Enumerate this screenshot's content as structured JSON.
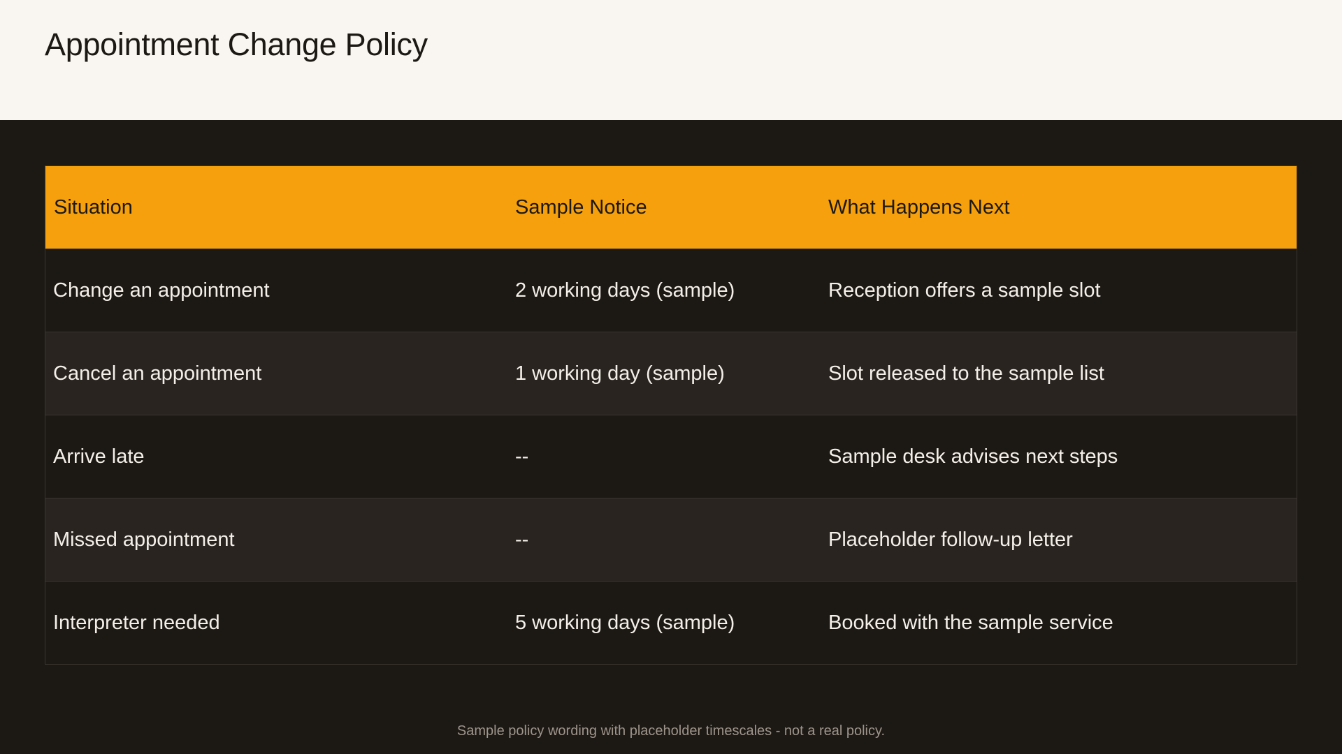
{
  "page": {
    "title": "Appointment Change Policy",
    "footnote": "Sample policy wording with placeholder timescales - not a real policy."
  },
  "table": {
    "headers": [
      "Situation",
      "Sample Notice",
      "What Happens Next"
    ],
    "rows": [
      [
        "Change an appointment",
        "2 working days (sample)",
        "Reception offers a sample slot"
      ],
      [
        "Cancel an appointment",
        "1 working day (sample)",
        "Slot released to the sample list"
      ],
      [
        "Arrive late",
        "--",
        "Sample desk advises next steps"
      ],
      [
        "Missed appointment",
        "--",
        "Placeholder follow-up letter"
      ],
      [
        "Interpreter needed",
        "5 working days (sample)",
        "Booked with the sample service"
      ]
    ]
  },
  "colors": {
    "header_band": "#f9f6f1",
    "page_background": "#1c1814",
    "table_header": "#f5a00c",
    "row_dark": "#1c1814",
    "row_alt": "#292420",
    "body_text": "#f4efe8",
    "footnote_text": "#9e958b"
  }
}
